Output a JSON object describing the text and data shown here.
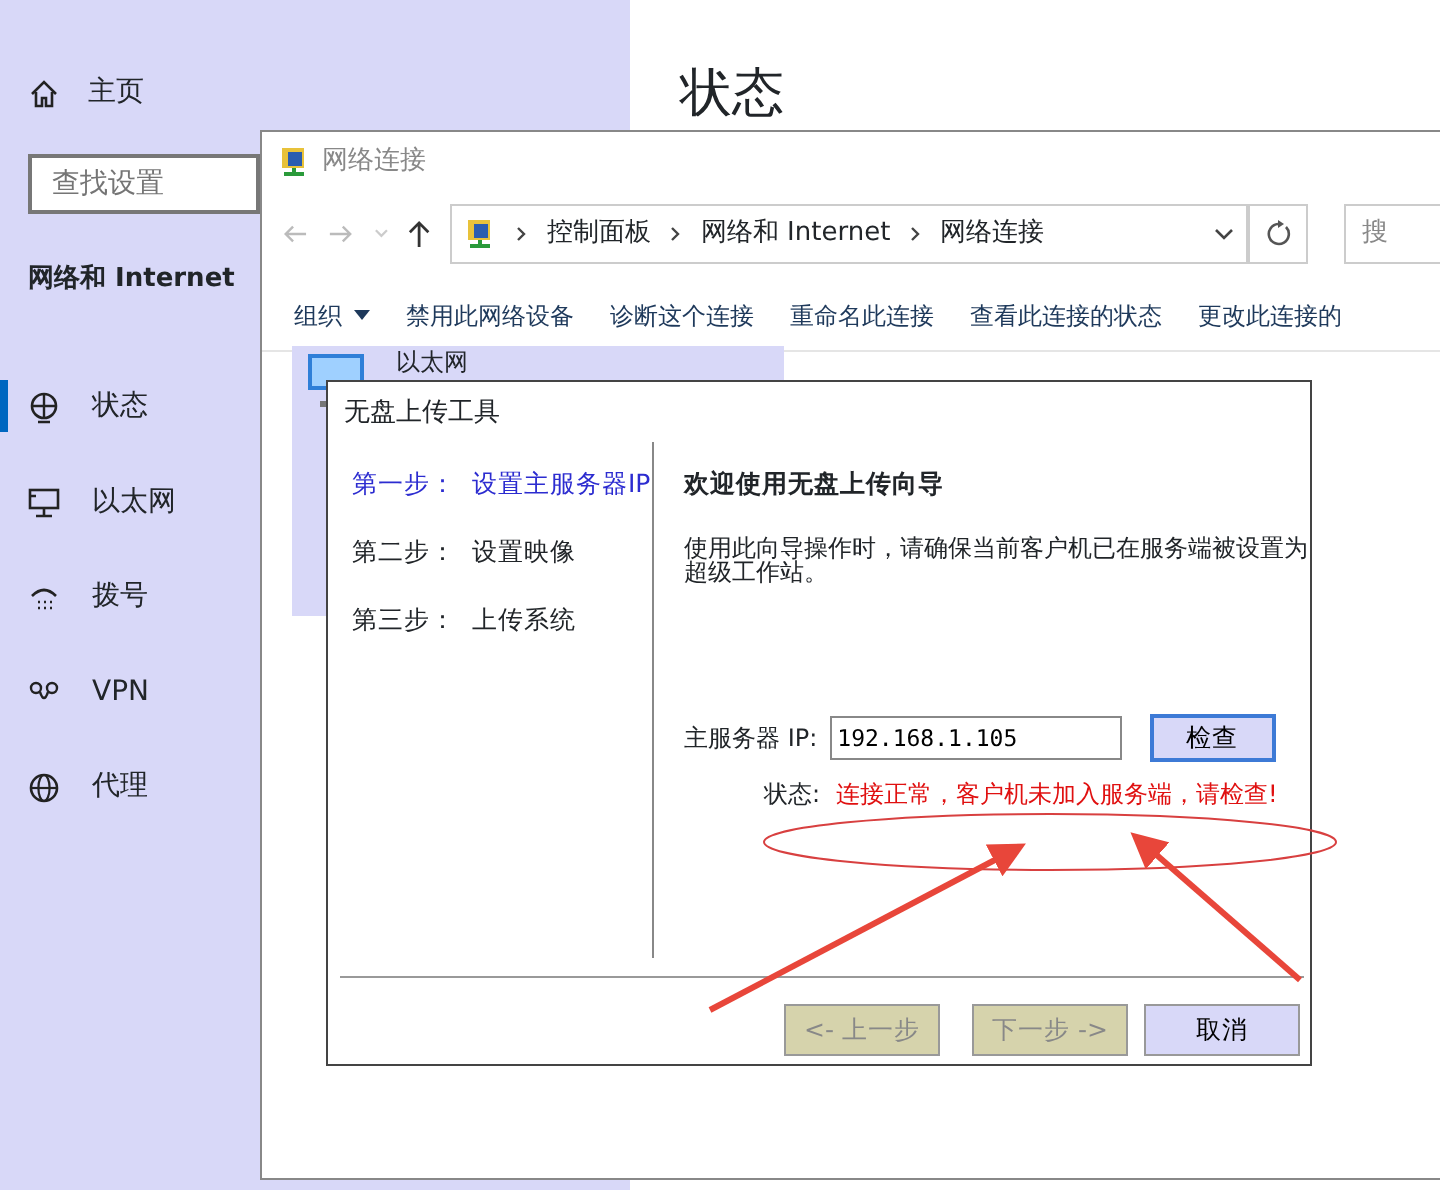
{
  "settings": {
    "home": {
      "label": "主页"
    },
    "search": {
      "placeholder": "查找设置"
    },
    "section": "网络和 Internet",
    "page_title": "状态",
    "items": [
      {
        "kind": "status",
        "label": "状态",
        "selected": true
      },
      {
        "kind": "ethernet",
        "label": "以太网",
        "selected": false
      },
      {
        "kind": "dialup",
        "label": "拨号",
        "selected": false
      },
      {
        "kind": "vpn",
        "label": "VPN",
        "selected": false
      },
      {
        "kind": "proxy",
        "label": "代理",
        "selected": false
      }
    ]
  },
  "explorer": {
    "title": "网络连接",
    "breadcrumb": [
      "控制面板",
      "网络和 Internet",
      "网络连接"
    ],
    "search": {
      "placeholder": "搜"
    },
    "toolbar": [
      {
        "label": "组织",
        "dropdown": true
      },
      {
        "label": "禁用此网络设备",
        "dropdown": false
      },
      {
        "label": "诊断这个连接",
        "dropdown": false
      },
      {
        "label": "重命名此连接",
        "dropdown": false
      },
      {
        "label": "查看此连接的状态",
        "dropdown": false
      },
      {
        "label": "更改此连接的",
        "dropdown": false
      }
    ],
    "items": [
      {
        "label": "以太网",
        "selected": true
      }
    ]
  },
  "wizard": {
    "title": "无盘上传工具",
    "steps": [
      {
        "step": "第一步：",
        "label": "设置主服务器IP",
        "selected": true
      },
      {
        "step": "第二步：",
        "label": "设置映像",
        "selected": false
      },
      {
        "step": "第三步：",
        "label": "上传系统",
        "selected": false
      }
    ],
    "heading": "欢迎使用无盘上传向导",
    "description": "使用此向导操作时，请确保当前客户机已在服务端被设置为超级工作站。",
    "ip_label": "主服务器 IP:",
    "ip_value": "192.168.1.105",
    "check_button": "检查",
    "status_label": "状态:",
    "status_message": "连接正常，客户机未加入服务端，请检查!",
    "buttons": [
      {
        "label": "<- 上一步",
        "disabled": true
      },
      {
        "label": "下一步 ->",
        "disabled": true
      },
      {
        "label": "取消",
        "disabled": false
      }
    ]
  }
}
